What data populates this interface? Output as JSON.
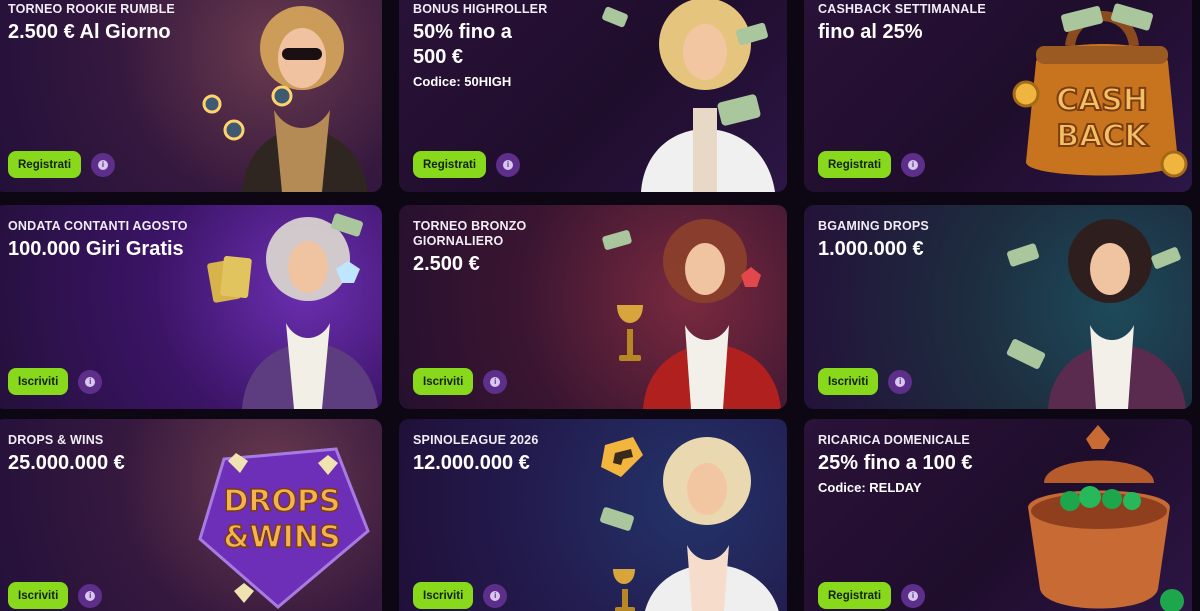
{
  "cards": [
    {
      "label": "TORNEO ROOKIE RUMBLE",
      "headline": "2.500 € Al Giorno",
      "code": "",
      "cta": "Registrati",
      "info": "i",
      "theme": "#b47c2f"
    },
    {
      "label": "BONUS HIGHROLLER",
      "headline": "50% fino a 500 €",
      "code": "Codice: 50HIGH",
      "cta": "Registrati",
      "info": "i",
      "theme": "#f0f0f0"
    },
    {
      "label": "CASHBACK SETTIMANALE",
      "headline": "fino al 25%",
      "code": "",
      "cta": "Registrati",
      "info": "i",
      "theme": "#c8741f"
    },
    {
      "label": "ONDATA CONTANTI AGOSTO",
      "headline": "100.000 Giri Gratis",
      "code": "",
      "cta": "Iscriviti",
      "info": "i",
      "theme": "#6b3f8f"
    },
    {
      "label": "TORNEO BRONZO GIORNALIERO",
      "headline": "2.500 €",
      "code": "",
      "cta": "Iscriviti",
      "info": "i",
      "theme": "#b0201f"
    },
    {
      "label": "BGAMING DROPS",
      "headline": "1.000.000 €",
      "code": "",
      "cta": "Iscriviti",
      "info": "i",
      "theme": "#5a2b4f"
    },
    {
      "label": "DROPS & WINS",
      "headline": "25.000.000 €",
      "code": "",
      "cta": "Iscriviti",
      "info": "i",
      "theme": "#f2a633",
      "logo_line1": "DROPS",
      "logo_line2": "&WINS"
    },
    {
      "label": "SPINOLEAGUE 2026",
      "headline": "12.000.000 €",
      "code": "",
      "cta": "Iscriviti",
      "info": "i",
      "theme": "#eeeeee"
    },
    {
      "label": "RICARICA DOMENICALE",
      "headline": "25% fino a 100 €",
      "code": "Codice: RELDAY",
      "cta": "Registrati",
      "info": "i",
      "theme": "#c76a34"
    }
  ],
  "icons": {
    "info": "info-icon",
    "cash_bag": "cashback-bag-icon",
    "chips": "casino-chip-icon",
    "banknotes": "banknote-icon",
    "trophy": "trophy-icon",
    "gem": "gem-icon",
    "treasure_pot": "treasure-pot-icon",
    "spino_logo": "spinoleague-logo-icon"
  },
  "cashbag_logo": {
    "line1": "CASH",
    "line2": "BACK"
  }
}
